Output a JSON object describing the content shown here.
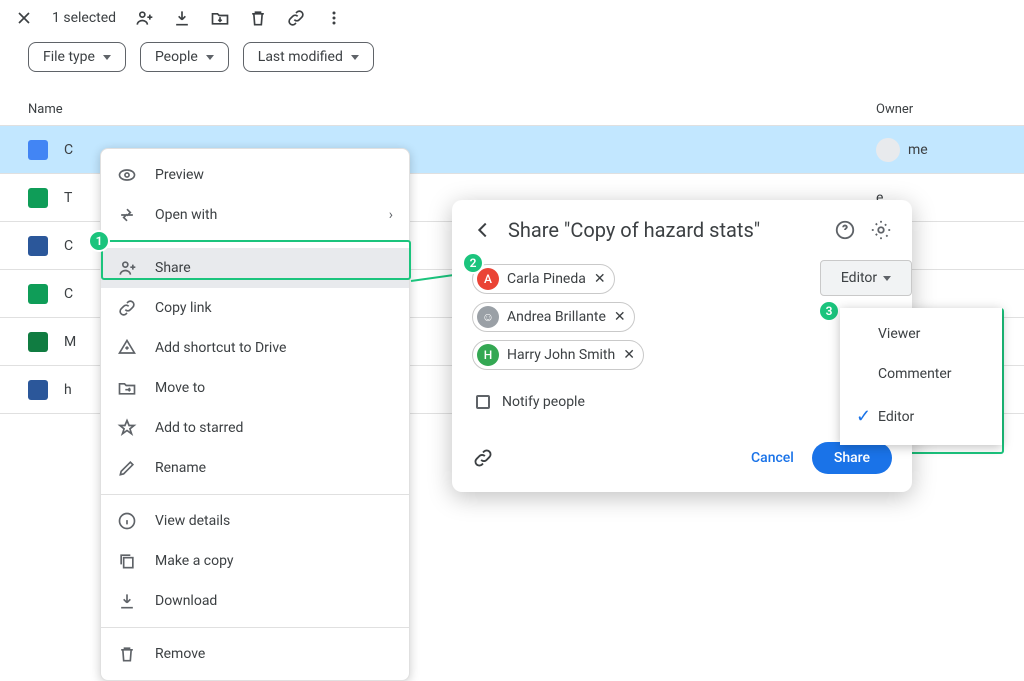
{
  "toolbar": {
    "selection_text": "1 selected"
  },
  "filters": {
    "filetype": "File type",
    "people": "People",
    "last_modified": "Last modified"
  },
  "columns": {
    "name": "Name",
    "owner": "Owner"
  },
  "rows": [
    {
      "letter": "C",
      "type": "docs",
      "owner": "me"
    },
    {
      "letter": "T",
      "type": "sheets",
      "owner": "e"
    },
    {
      "letter": "C",
      "type": "word",
      "owner": "e"
    },
    {
      "letter": "C",
      "type": "sheets",
      "owner": "e"
    },
    {
      "letter": "M",
      "type": "excel",
      "owner": ""
    },
    {
      "letter": "h",
      "type": "word",
      "owner": ""
    }
  ],
  "context_menu": {
    "preview": "Preview",
    "open_with": "Open with",
    "share": "Share",
    "copy_link": "Copy link",
    "add_shortcut": "Add shortcut to Drive",
    "move_to": "Move to",
    "add_starred": "Add to starred",
    "rename": "Rename",
    "view_details": "View details",
    "make_copy": "Make a copy",
    "download": "Download",
    "remove": "Remove"
  },
  "dialog": {
    "title": "Share \"Copy of hazard stats\"",
    "notify": "Notify people",
    "cancel": "Cancel",
    "share": "Share"
  },
  "people": [
    {
      "name": "Carla Pineda",
      "initial": "A",
      "color": "#ea4335"
    },
    {
      "name": "Andrea Brillante",
      "initial": "☺",
      "color": "#9aa0a6"
    },
    {
      "name": "Harry John Smith",
      "initial": "H",
      "color": "#34a853"
    }
  ],
  "role_trigger": "Editor",
  "role_options": [
    {
      "label": "Viewer",
      "selected": false
    },
    {
      "label": "Commenter",
      "selected": false
    },
    {
      "label": "Editor",
      "selected": true
    }
  ]
}
